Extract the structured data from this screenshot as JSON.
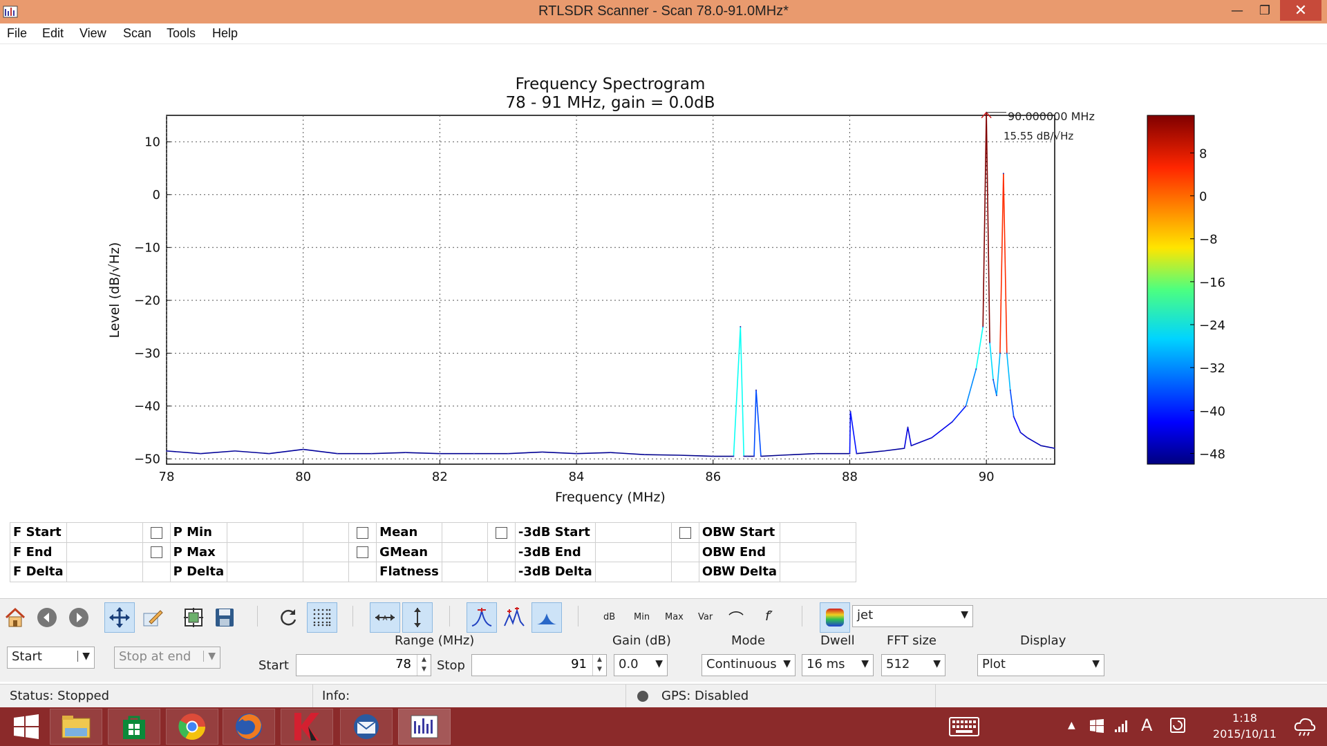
{
  "window": {
    "title": "RTLSDR Scanner - Scan 78.0-91.0MHz*",
    "minimize": "—",
    "maximize": "❐",
    "close": "✕"
  },
  "menu": [
    "File",
    "Edit",
    "View",
    "Scan",
    "Tools",
    "Help"
  ],
  "chart_data": {
    "type": "line",
    "title": "Frequency Spectrogram",
    "subtitle": "78 - 91 MHz, gain = 0.0dB",
    "xlabel": "Frequency (MHz)",
    "ylabel": "Level (dB/√Hz)",
    "xlim": [
      78,
      91
    ],
    "ylim": [
      -51,
      15
    ],
    "xticks": [
      78,
      80,
      82,
      84,
      86,
      88,
      90
    ],
    "yticks": [
      10,
      0,
      -10,
      -20,
      -30,
      -40,
      -50
    ],
    "grid": true,
    "noise_floor_db": -49,
    "series": [
      {
        "x": [
          78,
          78.5,
          79,
          79.5,
          80,
          80.5,
          81,
          81.5,
          82,
          82.5,
          83,
          83.5,
          84,
          84.5,
          85,
          85.5,
          86,
          86.3,
          86.4,
          86.45,
          86.5,
          86.6,
          86.63,
          86.7,
          87,
          87.5,
          88,
          88.01,
          88.1,
          88.5,
          88.8,
          88.85,
          88.9,
          89.2,
          89.5,
          89.7,
          89.85,
          89.95,
          90.0,
          90.05,
          90.1,
          90.15,
          90.2,
          90.25,
          90.3,
          90.35,
          90.4,
          90.5,
          90.6,
          90.8,
          91
        ],
        "y": [
          -48.5,
          -49,
          -48.5,
          -49,
          -48.2,
          -49,
          -49,
          -48.8,
          -49,
          -49,
          -49,
          -48.7,
          -49,
          -48.8,
          -49.2,
          -49.3,
          -49.5,
          -49.5,
          -25,
          -49.5,
          -49.5,
          -49.5,
          -37,
          -49.5,
          -49.3,
          -49,
          -49,
          -41,
          -49,
          -48.5,
          -48,
          -44,
          -47.5,
          -46,
          -43,
          -40,
          -33,
          -25,
          15.55,
          -28,
          -35,
          -38,
          -30,
          4,
          -30,
          -37,
          -42,
          -45,
          -46,
          -47.5,
          -48
        ]
      }
    ],
    "peak_annotation": {
      "freq_text": "90.000000 MHz",
      "level_text": "15.55 dB/√Hz",
      "x": 90.0,
      "y": 15.55
    },
    "colorbar": {
      "colormap": "jet",
      "range": [
        -50,
        15
      ],
      "ticks": [
        8,
        0,
        -8,
        -16,
        -24,
        -32,
        -40,
        -48
      ]
    }
  },
  "measurements": {
    "col1": [
      "F Start",
      "F End",
      "F Delta"
    ],
    "col2": [
      "P Min",
      "P Max",
      "P Delta"
    ],
    "col3": [
      "Mean",
      "GMean",
      "Flatness"
    ],
    "col4": [
      "-3dB Start",
      "-3dB End",
      "-3dB Delta"
    ],
    "col5": [
      "OBW Start",
      "OBW End",
      "OBW Delta"
    ]
  },
  "toolbar": {
    "labels": {
      "db": "dB",
      "min": "Min",
      "max": "Max",
      "var": "Var",
      "smooth": "⌒",
      "deriv": "f′"
    },
    "colormap": "jet"
  },
  "controls": {
    "range_label": "Range (MHz)",
    "start_label": "Start",
    "stop_label": "Stop",
    "start_value": "78",
    "stop_value": "91",
    "gain_label": "Gain (dB)",
    "gain_value": "0.0",
    "mode_label": "Mode",
    "mode_value": "Continuous",
    "dwell_label": "Dwell",
    "dwell_value": "16 ms",
    "fft_label": "FFT size",
    "fft_value": "512",
    "display_label": "Display",
    "display_value": "Plot",
    "start_button": "Start",
    "stop_at_end_button": "Stop at end"
  },
  "status": {
    "status": "Status: Stopped",
    "info": "Info:",
    "gps": "GPS: Disabled"
  },
  "taskbar": {
    "time": "1:18",
    "date": "2015/10/11",
    "ime": "A"
  },
  "colors": {
    "titlebar": "#e99a6e",
    "taskbar": "#8b2a2a",
    "trace": "#3030b0"
  }
}
